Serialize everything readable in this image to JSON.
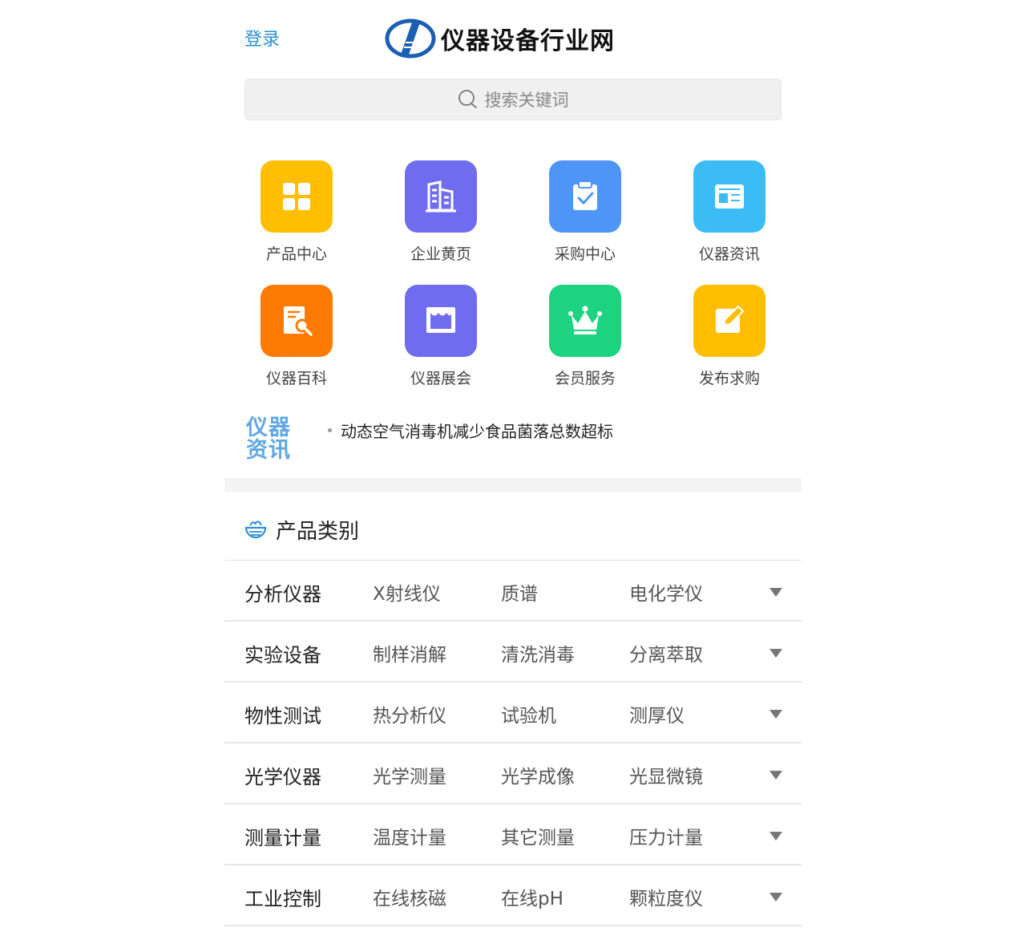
{
  "header": {
    "login_label": "登录",
    "logo_text": "仪器设备行业网"
  },
  "search": {
    "placeholder": "搜索关键词"
  },
  "nav_grid": [
    {
      "label": "产品中心",
      "icon": "grid-icon",
      "color": "#ffbf00"
    },
    {
      "label": "企业黄页",
      "icon": "building-icon",
      "color": "#6f6cf0"
    },
    {
      "label": "采购中心",
      "icon": "clipboard-check-icon",
      "color": "#4f95f7"
    },
    {
      "label": "仪器资讯",
      "icon": "news-icon",
      "color": "#3bbcf5"
    },
    {
      "label": "仪器百科",
      "icon": "book-search-icon",
      "color": "#ff7a00"
    },
    {
      "label": "仪器展会",
      "icon": "exhibition-icon",
      "color": "#6f6cf0"
    },
    {
      "label": "会员服务",
      "icon": "crown-icon",
      "color": "#1ed37f"
    },
    {
      "label": "发布求购",
      "icon": "edit-icon",
      "color": "#ffbf00"
    }
  ],
  "news": {
    "badge": "仪器资讯",
    "items": [
      "动态空气消毒机减少食品菌落总数超标"
    ]
  },
  "category": {
    "title": "产品类别",
    "rows": [
      {
        "main": "分析仪器",
        "subs": [
          "X射线仪",
          "质谱",
          "电化学仪"
        ]
      },
      {
        "main": "实验设备",
        "subs": [
          "制样消解",
          "清洗消毒",
          "分离萃取"
        ]
      },
      {
        "main": "物性测试",
        "subs": [
          "热分析仪",
          "试验机",
          "测厚仪"
        ]
      },
      {
        "main": "光学仪器",
        "subs": [
          "光学测量",
          "光学成像",
          "光显微镜"
        ]
      },
      {
        "main": "测量计量",
        "subs": [
          "温度计量",
          "其它测量",
          "压力计量"
        ]
      },
      {
        "main": "工业控制",
        "subs": [
          "在线核磁",
          "在线pH",
          "颗粒度仪"
        ]
      }
    ]
  },
  "colors": {
    "accent": "#2a8fd8",
    "badge": "#5fa8e6"
  }
}
